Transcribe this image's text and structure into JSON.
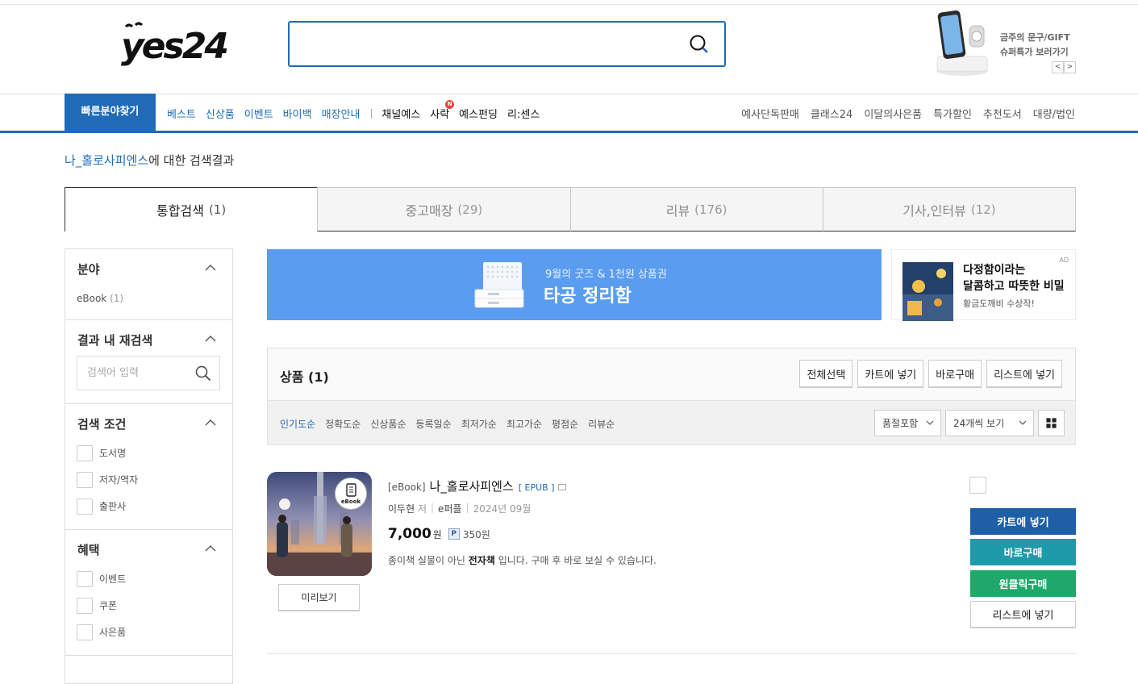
{
  "header": {
    "logo_text": "yes24",
    "search": {
      "value": "",
      "placeholder": ""
    },
    "top_ad": {
      "line1": "금주의 문구/GIFT",
      "line2": "슈퍼특가 보러가기",
      "prev": "<",
      "next": ">"
    }
  },
  "nav": {
    "quick_find": "빠른분야찾기",
    "left_blue": [
      "베스트",
      "신상품",
      "이벤트",
      "바이백",
      "매장안내"
    ],
    "left_dark": [
      "채널예스",
      "사락",
      "예스펀딩",
      "리:센스"
    ],
    "new_badge": "N",
    "right": [
      "예사단독판매",
      "클래스24",
      "이달의사은품",
      "특가할인",
      "추천도서",
      "대량/법인"
    ]
  },
  "result": {
    "keyword": "나_홀로사피엔스",
    "suffix": "에 대한 검색결과"
  },
  "tabs": [
    {
      "label": "통합검색",
      "count": "(1)"
    },
    {
      "label": "중고매장",
      "count": "(29)"
    },
    {
      "label": "리뷰",
      "count": "(176)"
    },
    {
      "label": "기사,인터뷰",
      "count": "(12)"
    }
  ],
  "sidebar": {
    "category": {
      "title": "분야",
      "item": "eBook",
      "item_count": "(1)"
    },
    "research": {
      "title": "결과 내 재검색",
      "placeholder": "검색어 입력"
    },
    "conditions": {
      "title": "검색 조건",
      "items": [
        "도서명",
        "저자/역자",
        "출판사"
      ]
    },
    "benefits": {
      "title": "혜택",
      "items": [
        "이벤트",
        "쿠폰",
        "사은품"
      ]
    }
  },
  "banner": {
    "sub": "9월의 굿즈 & 1천원 상품권",
    "main": "타공 정리함"
  },
  "side_ad": {
    "line1": "다정함이라는",
    "line2": "달콤하고 따뜻한 비밀",
    "line3": "황금도깨비 수상작!",
    "tag": "AD"
  },
  "products": {
    "title": "상품 (1)",
    "buttons": [
      "전체선택",
      "카트에 넣기",
      "바로구매",
      "리스트에 넣기"
    ],
    "sorts": [
      "인기도순",
      "정확도순",
      "신상품순",
      "등록일순",
      "최저가순",
      "최고가순",
      "평점순",
      "리뷰순"
    ],
    "filter_select": "품절포함",
    "per_page": "24개씩 보기"
  },
  "item": {
    "prefix": "[eBook]",
    "title": "나_홀로사피엔스",
    "format": "[ EPUB ]",
    "author": "이두현",
    "author_role": "저",
    "publisher": "e퍼플",
    "date": "2024년 09월",
    "price": "7,000",
    "won": "원",
    "point_icon": "P",
    "points": "350원",
    "desc_a": "종이책 실물이 아닌 ",
    "desc_b": "전자책",
    "desc_c": " 입니다. 구매 후 바로 보실 수 있습니다.",
    "ebook_badge": "eBook",
    "preview": "미리보기",
    "actions": {
      "cart": "카트에 넣기",
      "buy": "바로구매",
      "oneclick": "원클릭구매",
      "list": "리스트에 넣기"
    }
  },
  "colors": {
    "brand_blue": "#1f6bb8",
    "buy_teal": "#1f9aaa",
    "oneclick_green": "#20a86b",
    "banner_blue": "#5a9cf0"
  }
}
